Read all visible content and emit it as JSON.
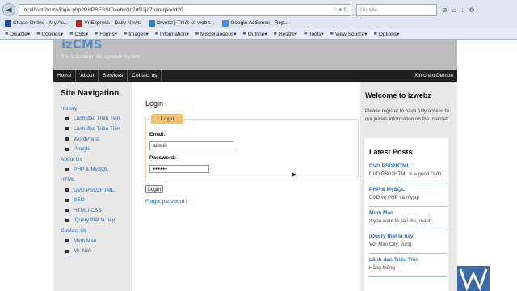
{
  "browser": {
    "url": "localhost/izcms/login.php?PHPSESSID=ehvi3q2d9l2jo7nareqasdd20",
    "search_placeholder": "Google",
    "bookmarks": [
      {
        "label": "Chase Online - My Ac...",
        "color": "#1b4e9b"
      },
      {
        "label": "VnExpress - Daily News",
        "color": "#b5261e"
      },
      {
        "label": "Izwebz | Thiết kế web t...",
        "color": "#2d7fc1"
      },
      {
        "label": "Google AdSense - Rep...",
        "color": "#4285f4"
      }
    ],
    "webdev_toolbar": [
      {
        "label": "Disable▾",
        "icon": "no-icon"
      },
      {
        "label": "Cookies▾",
        "icon": "cookie-icon"
      },
      {
        "label": "CSS▾",
        "icon": "css-icon"
      },
      {
        "label": "Forms▾",
        "icon": "forms-icon"
      },
      {
        "label": "Images▾",
        "icon": "image-icon"
      },
      {
        "label": "Information▾",
        "icon": "info-icon"
      },
      {
        "label": "Miscellaneous▾",
        "icon": "misc-icon"
      },
      {
        "label": "Outline▾",
        "icon": "outline-icon"
      },
      {
        "label": "Resize▾",
        "icon": "resize-icon"
      },
      {
        "label": "Tools▾",
        "icon": "tools-icon"
      },
      {
        "label": "View Source▾",
        "icon": "source-icon"
      },
      {
        "label": "Options▾",
        "icon": "options-icon"
      }
    ]
  },
  "site": {
    "logo": "izCMS",
    "tagline": "The iz Content Management System",
    "menu": [
      "Home",
      "About",
      "Services",
      "Contact us"
    ],
    "greeting": "Xin chào Demon"
  },
  "sidebar": {
    "title": "Site Navigation",
    "items": [
      {
        "label": "History",
        "type": "cat"
      },
      {
        "label": "Lãnh đạo Triều Tiên",
        "type": "sub"
      },
      {
        "label": "Lãnh đạo Triều Tiên",
        "type": "sub"
      },
      {
        "label": "WordPress",
        "type": "sub"
      },
      {
        "label": "Google",
        "type": "sub"
      },
      {
        "label": "About Us",
        "type": "cat"
      },
      {
        "label": "PHP & MySQL",
        "type": "sub"
      },
      {
        "label": "HTML",
        "type": "cat"
      },
      {
        "label": "DVD PSD2HTML",
        "type": "sub"
      },
      {
        "label": "SEO",
        "type": "sub"
      },
      {
        "label": "HTML/ CSS",
        "type": "sub"
      },
      {
        "label": "jQuery thật là hay",
        "type": "sub"
      },
      {
        "label": "Contact Us",
        "type": "cat"
      },
      {
        "label": "Minh Man",
        "type": "sub"
      },
      {
        "label": "Mr. Nav",
        "type": "sub"
      }
    ]
  },
  "login": {
    "heading": "Login",
    "legend": "Login",
    "email_label": "Email:",
    "email_value": "admin",
    "password_label": "Password:",
    "password_value": "●●●●●●",
    "submit": "Login",
    "forgot": "Forgot password?"
  },
  "right": {
    "welcome_title": "Welcome to izwebz",
    "welcome_text": "Please register to have fully access to our juicies information on the Internet.",
    "posts_title": "Latest Posts",
    "posts": [
      {
        "title": "DVD PSD2HTML",
        "desc": "DVD PSD2HTML is a good DVD"
      },
      {
        "title": "PHP & MySQL",
        "desc": "DVD về PHP và mysql"
      },
      {
        "title": "Minh Man",
        "desc": "If you want to call me, reach"
      },
      {
        "title": "jQuery thật là hay",
        "desc": "Với Man City, vùng"
      },
      {
        "title": "Lãnh đạo Triều Tiên",
        "desc": "Hằng thông"
      }
    ]
  }
}
